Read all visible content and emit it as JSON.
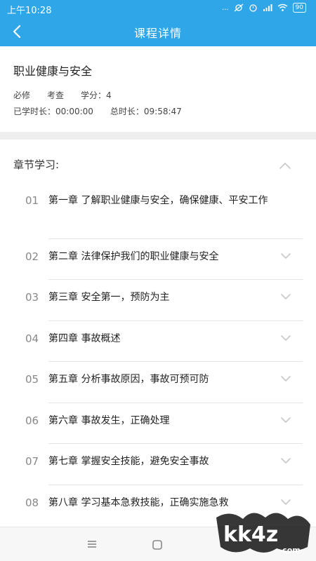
{
  "status_bar": {
    "time": "上午10:28",
    "network": "...",
    "battery": "90",
    "icons": [
      "alarm-off-icon",
      "alarm-icon",
      "signal-icon",
      "wifi-icon",
      "battery-icon"
    ]
  },
  "nav": {
    "title": "课程详情",
    "back_icon": "chevron-left-icon"
  },
  "course": {
    "title": "职业健康与安全",
    "required": "必修",
    "assessment": "考查",
    "credits": "学分：4",
    "studied": "已学时长：00:00:00",
    "total": "总时长：09:58:47"
  },
  "chapters": {
    "heading": "章节学习:",
    "items": [
      {
        "num": "01",
        "title": "第一章 了解职业健康与安全，确保健康、平安工作"
      },
      {
        "num": "02",
        "title": "第二章 法律保护我们的职业健康与安全"
      },
      {
        "num": "03",
        "title": "第三章 安全第一，预防为主"
      },
      {
        "num": "04",
        "title": "第四章 事故概述"
      },
      {
        "num": "05",
        "title": "第五章 分析事故原因，事故可预可防"
      },
      {
        "num": "06",
        "title": "第六章 事故发生，正确处理"
      },
      {
        "num": "07",
        "title": "第七章 掌握安全技能，避免安全事故"
      },
      {
        "num": "08",
        "title": "第八章 学习基本急救技能，正确实施急救"
      }
    ]
  },
  "watermark": "kk4z.com",
  "colors": {
    "primary": "#2fa6e7",
    "divider": "#eeeeee",
    "muted": "#888888"
  }
}
